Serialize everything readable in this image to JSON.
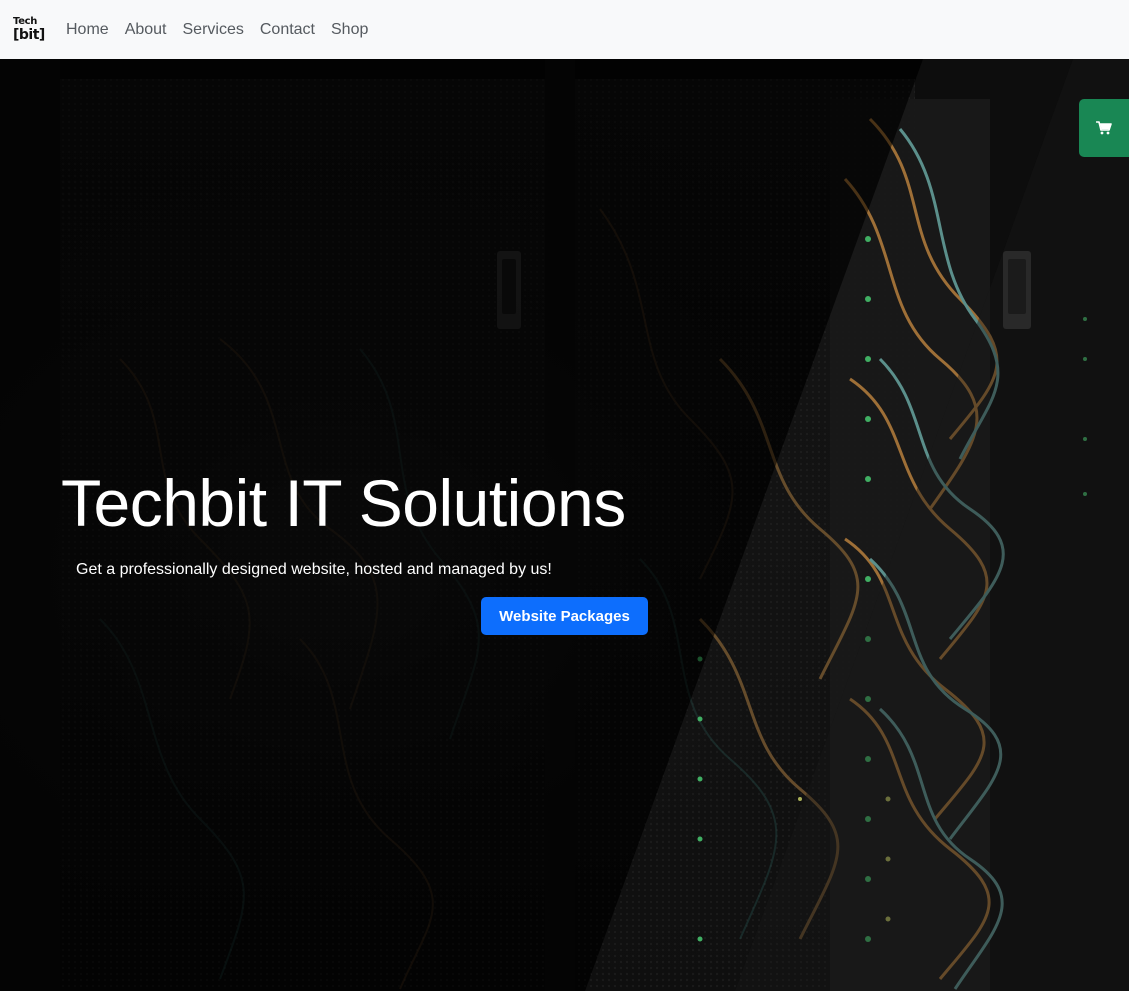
{
  "brand": {
    "top": "Tech",
    "bottom": "[bit]"
  },
  "nav": {
    "items": [
      {
        "label": "Home"
      },
      {
        "label": "About"
      },
      {
        "label": "Services"
      },
      {
        "label": "Contact"
      },
      {
        "label": "Shop"
      }
    ]
  },
  "hero": {
    "title": "Techbit IT Solutions",
    "subtitle": "Get a professionally designed website, hosted and managed by us!",
    "button_label": "Website Packages"
  },
  "cart": {
    "icon": "shopping-cart-icon"
  },
  "colors": {
    "navbar_bg": "#f8f9fa",
    "primary": "#0d6efd",
    "cart_green": "#198754",
    "hero_text": "#ffffff"
  }
}
